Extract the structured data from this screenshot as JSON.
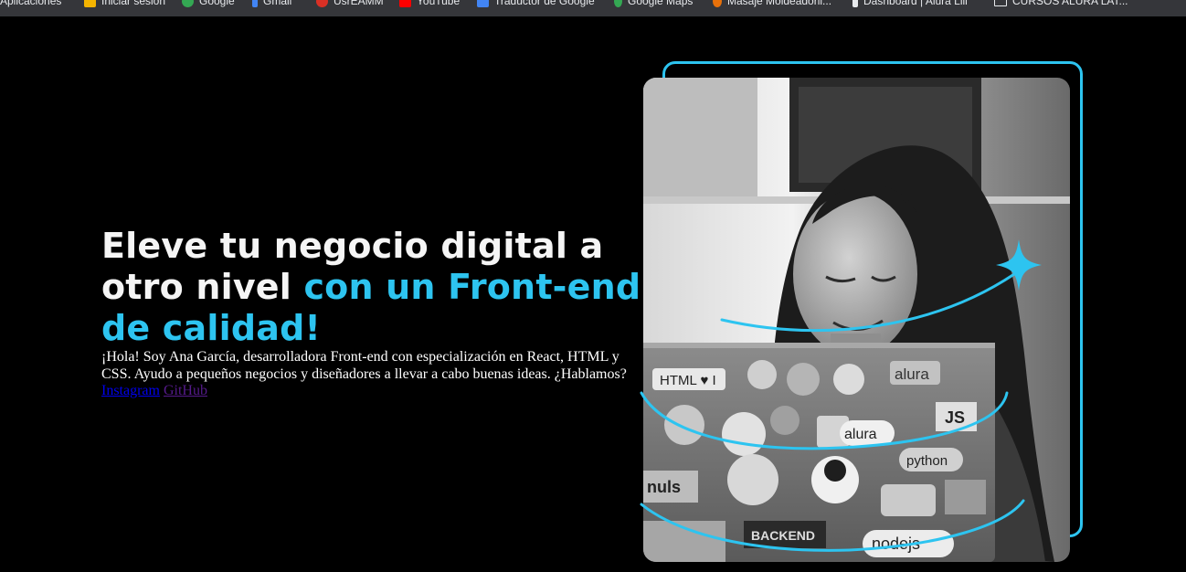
{
  "bookmarks": [
    {
      "label": "Aplicaciones",
      "icon": "apps-grid-icon",
      "color": "#8ab4f8"
    },
    {
      "label": "Iniciar sesión",
      "icon": "microsoft-icon",
      "color": "#f4b400"
    },
    {
      "label": "Google",
      "icon": "google-icon",
      "color": "#34a853"
    },
    {
      "label": "Gmail",
      "icon": "gmail-icon",
      "color": "#4285f4"
    },
    {
      "label": "UsrEAMM",
      "icon": "site-icon",
      "color": "#d93025"
    },
    {
      "label": "YouTube",
      "icon": "youtube-icon",
      "color": "#ff0000"
    },
    {
      "label": "Traductor de Google",
      "icon": "translate-icon",
      "color": "#4285f4"
    },
    {
      "label": "Google Maps",
      "icon": "maps-icon",
      "color": "#34a853"
    },
    {
      "label": "Masaje Moldeadoril...",
      "icon": "site-icon",
      "color": "#e8710a"
    },
    {
      "label": "Dashboard | Alura Lili",
      "icon": "alura-icon",
      "color": "#e8eaed"
    },
    {
      "label": "CURSOS ALURA LAT...",
      "icon": "folder-icon",
      "color": "#e8eaed"
    }
  ],
  "hero": {
    "title_plain": "Eleve tu negocio digital a otro nivel ",
    "title_accent": "con un Front-end de calidad!",
    "description": "¡Hola! Soy Ana García, desarrolladora Front-end con especialización en React, HTML y CSS. Ayudo a pequeños negocios y diseñadores a llevar a cabo buenas ideas. ¿Hablamos?",
    "links": {
      "instagram": "Instagram",
      "github": "GitHub"
    }
  },
  "image": {
    "description_icon": "portrait-photo"
  },
  "colors": {
    "background": "#000000",
    "accent": "#2dc4f0",
    "text": "#f5f5f5",
    "link": "#0000ee",
    "visited_link": "#551a8b"
  }
}
